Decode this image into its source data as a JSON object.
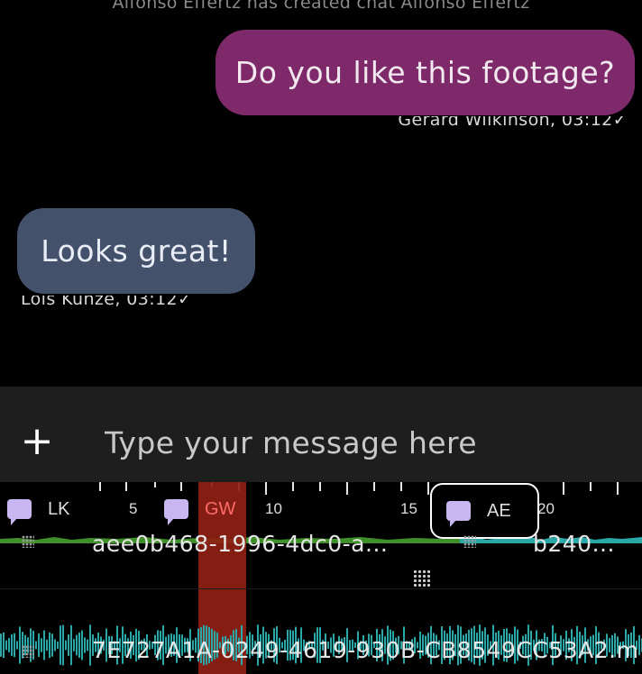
{
  "system_message": "Alfonso Effertz has created chat Alfonso Effertz",
  "messages": [
    {
      "text": "Do you like this footage?",
      "meta": "Gerard Wilkinson, 03:12✓",
      "direction": "outgoing",
      "color": "#7e2a6a"
    },
    {
      "text": "Looks great!",
      "meta": "Lois Kunze, 03:12✓",
      "direction": "incoming",
      "color": "#44516b"
    }
  ],
  "composer": {
    "add_icon": "plus-icon",
    "placeholder": "Type your message here"
  },
  "timeline": {
    "tick_labels": [
      "5",
      "10",
      "15",
      "20"
    ],
    "markers": [
      {
        "label": "LK",
        "icon": "comment-icon"
      },
      {
        "label": "GW",
        "icon": "comment-icon"
      },
      {
        "label": "AE",
        "icon": "comment-icon",
        "selected": true
      }
    ],
    "clips": [
      {
        "label": "aee0b468-1996-4dc0-a...",
        "color": "#3f8f2a"
      },
      {
        "label": "b240...",
        "color": "#2aa7a7"
      }
    ],
    "audio_clip_label": "7E727A1A-0249-4619-930B-CB8549CC53A2.m",
    "playhead_color": "#8f1f14",
    "marker_icon_color": "#c8b6f0"
  }
}
